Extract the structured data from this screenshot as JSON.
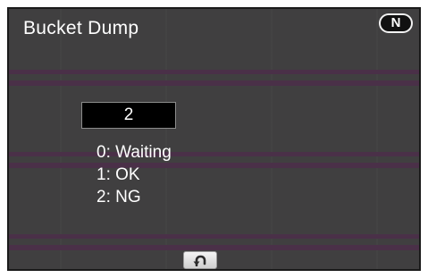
{
  "screen": {
    "title": "Bucket Dump",
    "mode_badge": "N",
    "current_value": "2",
    "options": [
      "0: Waiting",
      "1: OK",
      "2: NG"
    ],
    "back_icon": "return-arrow-icon"
  }
}
